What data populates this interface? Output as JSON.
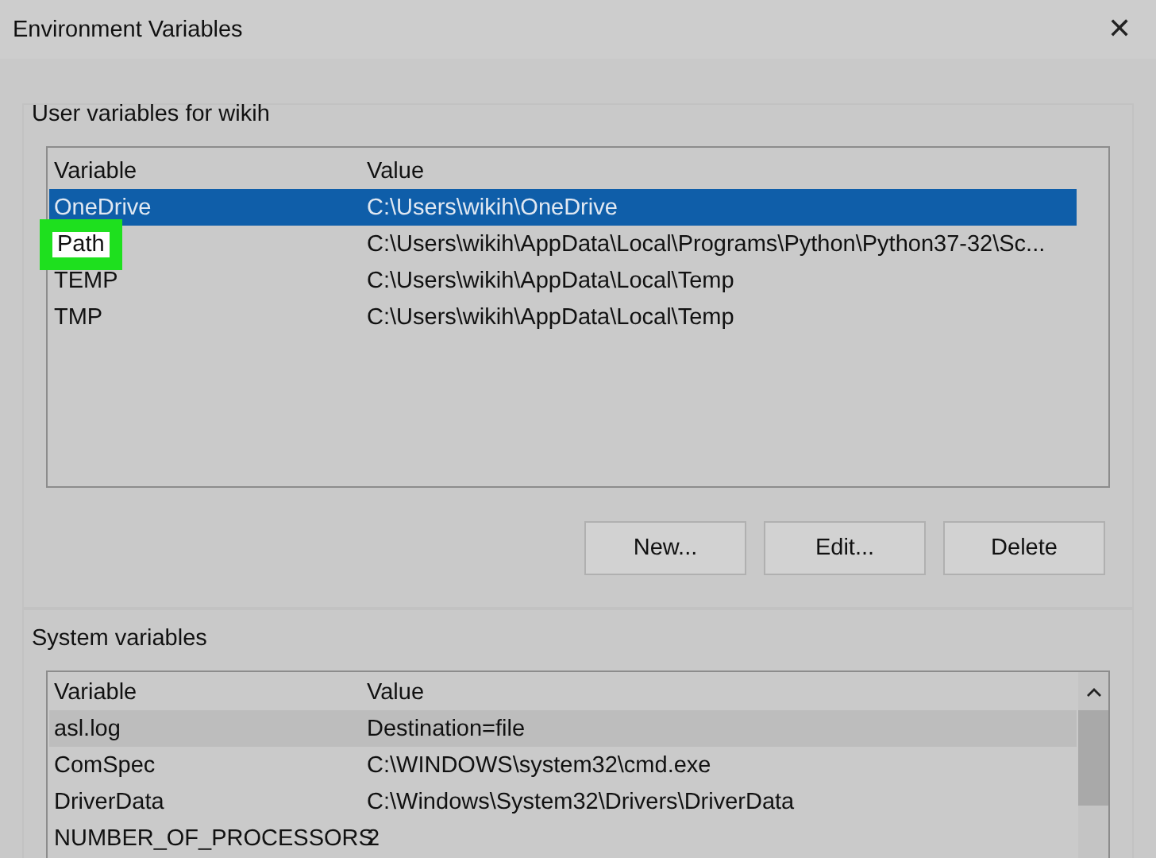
{
  "window": {
    "title": "Environment Variables",
    "close": "✕"
  },
  "user_variables": {
    "label": "User variables for wikih",
    "columns": [
      "Variable",
      "Value"
    ],
    "rows": [
      {
        "variable": "OneDrive",
        "value": "C:\\Users\\wikih\\OneDrive",
        "selected": true,
        "highlighted": false
      },
      {
        "variable": "Path",
        "value": "C:\\Users\\wikih\\AppData\\Local\\Programs\\Python\\Python37-32\\Sc...",
        "selected": false,
        "highlighted": true
      },
      {
        "variable": "TEMP",
        "value": "C:\\Users\\wikih\\AppData\\Local\\Temp",
        "selected": false,
        "highlighted": false
      },
      {
        "variable": "TMP",
        "value": "C:\\Users\\wikih\\AppData\\Local\\Temp",
        "selected": false,
        "highlighted": false
      }
    ],
    "buttons": [
      "New...",
      "Edit...",
      "Delete"
    ]
  },
  "system_variables": {
    "label": "System variables",
    "columns": [
      "Variable",
      "Value"
    ],
    "rows": [
      {
        "variable": "asl.log",
        "value": "Destination=file",
        "selected": false,
        "hovered": true
      },
      {
        "variable": "ComSpec",
        "value": "C:\\WINDOWS\\system32\\cmd.exe",
        "selected": false,
        "hovered": false
      },
      {
        "variable": "DriverData",
        "value": "C:\\Windows\\System32\\Drivers\\DriverData",
        "selected": false,
        "hovered": false
      },
      {
        "variable": "NUMBER_OF_PROCESSORS",
        "value": "2",
        "selected": false,
        "hovered": false
      }
    ]
  }
}
